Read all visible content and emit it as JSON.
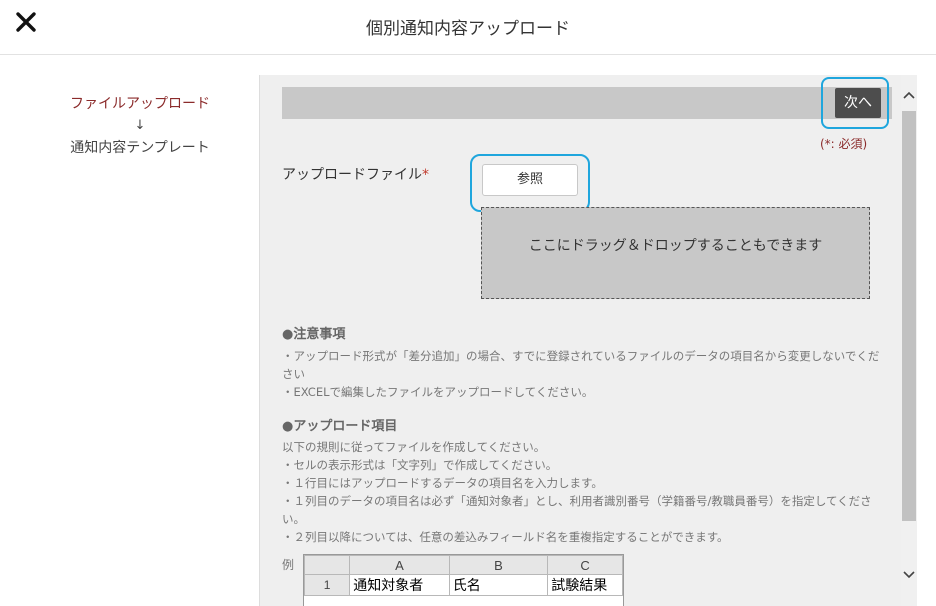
{
  "dialog": {
    "title": "個別通知内容アップロード",
    "close_icon": "close-icon"
  },
  "steps": {
    "current": "ファイルアップロード",
    "arrow": "↓",
    "next": "通知内容テンプレート"
  },
  "toolbar": {
    "next_label": "次へ",
    "required_note": "(*: 必須)"
  },
  "upload": {
    "label": "アップロードファイル",
    "required_mark": "*",
    "browse_label": "参照",
    "drop_text": "ここにドラッグ＆ドロップすることもできます"
  },
  "notes": {
    "title": "●注意事項",
    "lines": [
      "・アップロード形式が「差分追加」の場合、すでに登録されているファイルのデータの項目名から変更しないでください",
      "・EXCELで編集したファイルをアップロードしてください。"
    ]
  },
  "items": {
    "title": "●アップロード項目",
    "lines": [
      "以下の規則に従ってファイルを作成してください。",
      "・セルの表示形式は「文字列」で作成してください。",
      "・１行目にはアップロードするデータの項目名を入力します。",
      "・１列目のデータの項目名は必ず「通知対象者」とし、利用者識別番号（学籍番号/教職員番号）を指定してください。",
      "・２列目以降については、任意の差込みフィールド名を重複指定することができます。"
    ]
  },
  "example": {
    "label": "例",
    "columns": [
      "A",
      "B",
      "C"
    ],
    "rows": [
      {
        "num": "1",
        "cells": [
          "通知対象者",
          "氏名",
          "試験結果"
        ]
      }
    ]
  },
  "colors": {
    "accent_highlight": "#1fa6dd",
    "step_current": "#8b2b2b",
    "button_dark": "#4d4d4d"
  }
}
